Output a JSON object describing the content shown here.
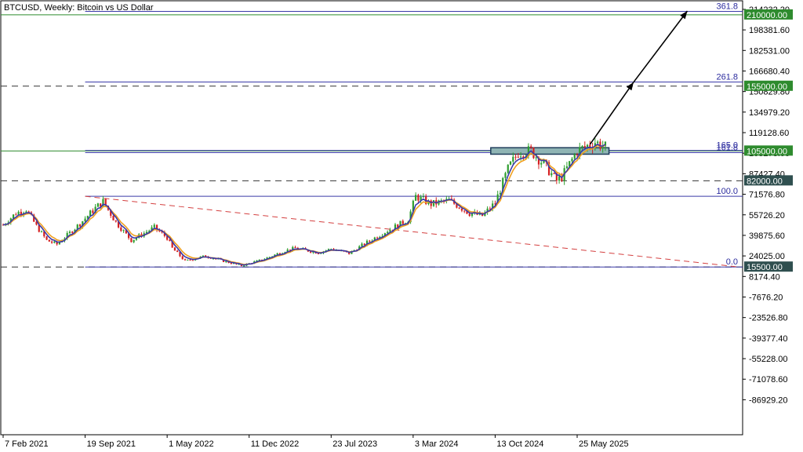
{
  "chart_title": "BTCUSD, Weekly:  Bitcoin vs US Dollar",
  "colors": {
    "bull": "#2e9e2e",
    "bear": "#d42020",
    "ma_fast": "#3a3aa8",
    "ma_slow": "#f0a020",
    "fib": "#3a3aa8",
    "trend": "#d44040",
    "level_dash": "#333333",
    "tag_green": "#2e8b2e",
    "tag_dark": "#2f4f4f",
    "zone_fill": "#8fb4b4",
    "zone_border": "#1e3c5a",
    "arrow": "#000000"
  },
  "chart_data": {
    "type": "candlestick",
    "title": "BTCUSD, Weekly:  Bitcoin vs US Dollar",
    "x_axis": {
      "type": "date",
      "range": [
        "2021-02-07",
        "2026-08-20"
      ],
      "tick_labels": [
        "7 Feb 2021",
        "19 Sep 2021",
        "1 May 2022",
        "11 Dec 2022",
        "23 Jul 2023",
        "3 Mar 2024",
        "13 Oct 2024",
        "25 May 2025"
      ]
    },
    "y_axis": {
      "range": [
        -100000,
        216000
      ],
      "tick_labels": [
        "214232.20",
        "198381.60",
        "182531.00",
        "166680.40",
        "150829.80",
        "134979.20",
        "119128.60",
        "103278.00",
        "87427.40",
        "71576.80",
        "55726.20",
        "39875.60",
        "24025.00",
        "8174.40",
        "-7676.20",
        "-23526.80",
        "-39377.40",
        "-55228.00",
        "-71078.60",
        "-86929.20"
      ]
    },
    "price_path": [
      [
        "2021-02-07",
        48000
      ],
      [
        "2021-03-14",
        57000
      ],
      [
        "2021-04-11",
        60000
      ],
      [
        "2021-05-09",
        47000
      ],
      [
        "2021-06-06",
        36000
      ],
      [
        "2021-07-04",
        33000
      ],
      [
        "2021-08-01",
        40000
      ],
      [
        "2021-09-05",
        49000
      ],
      [
        "2021-10-17",
        61000
      ],
      [
        "2021-11-07",
        66000
      ],
      [
        "2021-12-12",
        50000
      ],
      [
        "2022-01-23",
        36000
      ],
      [
        "2022-03-27",
        46000
      ],
      [
        "2022-05-01",
        38000
      ],
      [
        "2022-05-15",
        30000
      ],
      [
        "2022-06-19",
        20000
      ],
      [
        "2022-08-14",
        24000
      ],
      [
        "2022-10-09",
        19500
      ],
      [
        "2022-11-20",
        16500
      ],
      [
        "2023-01-15",
        21000
      ],
      [
        "2023-03-19",
        28000
      ],
      [
        "2023-04-16",
        30000
      ],
      [
        "2023-06-18",
        26500
      ],
      [
        "2023-07-23",
        29500
      ],
      [
        "2023-09-10",
        26000
      ],
      [
        "2023-10-29",
        34500
      ],
      [
        "2023-12-17",
        42500
      ],
      [
        "2024-02-18",
        52000
      ],
      [
        "2024-03-10",
        70000
      ],
      [
        "2024-04-21",
        64000
      ],
      [
        "2024-06-09",
        67000
      ],
      [
        "2024-08-04",
        57000
      ],
      [
        "2024-09-08",
        55000
      ],
      [
        "2024-10-13",
        65000
      ],
      [
        "2024-11-17",
        91000
      ],
      [
        "2024-12-15",
        104000
      ],
      [
        "2025-01-19",
        105000
      ],
      [
        "2025-02-23",
        95000
      ],
      [
        "2025-03-30",
        82000
      ],
      [
        "2025-04-13",
        85000
      ],
      [
        "2025-05-25",
        105000
      ],
      [
        "2025-07-13",
        112000
      ],
      [
        "2025-08-10",
        108000
      ]
    ],
    "moving_averages": [
      {
        "color": "ma_fast"
      },
      {
        "color": "ma_slow"
      }
    ],
    "price_tags": [
      {
        "value": 210000,
        "label": "210000.00",
        "color": "tag_green"
      },
      {
        "value": 155000,
        "label": "155000.00",
        "color": "tag_green"
      },
      {
        "value": 105000,
        "label": "105000.00",
        "color": "tag_green"
      },
      {
        "value": 82000,
        "label": "82000.00",
        "color": "tag_dark"
      },
      {
        "value": 15500,
        "label": "15500.00",
        "color": "tag_dark"
      }
    ],
    "fibonacci": {
      "anchor_date": "2021-09-19",
      "low": 15500,
      "high": 70000,
      "levels": [
        {
          "ratio": 0.0,
          "label": "0.0",
          "value": 15500
        },
        {
          "ratio": 1.0,
          "label": "100.0",
          "value": 70000
        },
        {
          "ratio": 1.618,
          "label": "161.8",
          "value": 103700
        },
        {
          "ratio": 1.65,
          "label": "165.0",
          "value": 105400
        },
        {
          "ratio": 2.618,
          "label": "261.8",
          "value": 158200
        },
        {
          "ratio": 3.618,
          "label": "361.8",
          "value": 212700
        }
      ]
    },
    "horizontal_levels": [
      {
        "value": 155000,
        "style": "dashed"
      },
      {
        "value": 82000,
        "style": "dashed"
      },
      {
        "value": 15500,
        "style": "dashed"
      },
      {
        "value": 210000,
        "style": "solid"
      },
      {
        "value": 105000,
        "style": "solid"
      }
    ],
    "trendline": {
      "from": [
        "2021-09-19",
        70000
      ],
      "to": [
        "2026-08-10",
        15500
      ]
    },
    "resistance_zone": {
      "from": "2024-10-01",
      "to": "2025-08-20",
      "low": 102500,
      "high": 107500
    },
    "projection_arrows": [
      {
        "from": [
          "2025-06-29",
          110000
        ],
        "to": [
          "2025-10-26",
          158000
        ]
      },
      {
        "from": [
          "2025-10-26",
          158000
        ],
        "to": [
          "2026-03-22",
          213000
        ]
      }
    ]
  }
}
